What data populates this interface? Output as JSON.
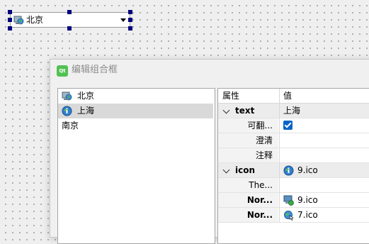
{
  "combo": {
    "text": "北京",
    "icon": "globe-computer-icon"
  },
  "dialog": {
    "title": "编辑组合框",
    "app_icon_text": "Qt",
    "list_items": [
      {
        "label": "北京",
        "icon": "globe-computer-icon"
      },
      {
        "label": "上海",
        "icon": "info-globe-icon",
        "selected": true
      },
      {
        "label": "南京",
        "icon": null
      }
    ]
  },
  "properties": {
    "header": {
      "name": "属性",
      "value": "值"
    },
    "rows": [
      {
        "type": "group",
        "name": "text",
        "value": "上海"
      },
      {
        "type": "child",
        "name": "可翻...",
        "value_kind": "checkbox",
        "checked": true
      },
      {
        "type": "child",
        "name": "澄清",
        "value": ""
      },
      {
        "type": "child",
        "name": "注释",
        "value": ""
      },
      {
        "type": "group",
        "name": "icon",
        "value": "9.ico",
        "icon": "info-globe-icon"
      },
      {
        "type": "child",
        "name": "The...",
        "value": ""
      },
      {
        "type": "child-bold",
        "name": "Nor...",
        "value": "9.ico",
        "icon": "computer-globe-icon"
      },
      {
        "type": "child-bold",
        "name": "Nor...",
        "value": "7.ico",
        "icon": "globe-cursor-icon"
      }
    ]
  }
}
